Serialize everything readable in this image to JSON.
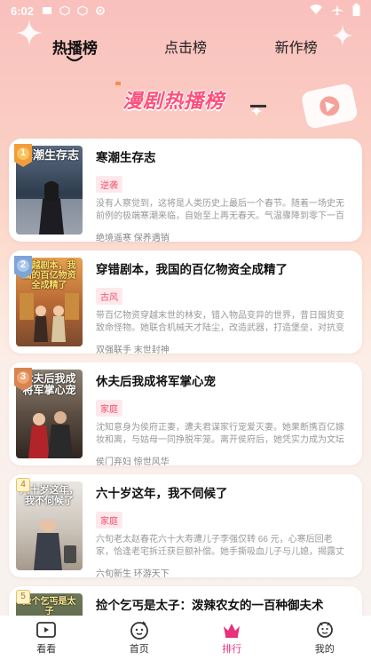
{
  "status_bar": {
    "time": "6:02"
  },
  "tabs": [
    {
      "label": "热播榜",
      "active": true
    },
    {
      "label": "点击榜",
      "active": false
    },
    {
      "label": "新作榜",
      "active": false
    }
  ],
  "banner": {
    "title": "漫剧热播榜"
  },
  "items": [
    {
      "rank": "1",
      "cover_text": "寒潮生存志",
      "title": "寒潮生存志",
      "tag": "逆袭",
      "desc": "没有人察觉到，这将是人类历史上最后一个春节。随着一场史无前例的极端寒潮来临，自始至上再无春天。气温骤降到零下一百度，…",
      "cast": "绝境遥寒  保养遇销"
    },
    {
      "rank": "2",
      "cover_text": "穿越剧本，我国的百亿物资全成精了",
      "title": "穿错剧本，我国的百亿物资全成精了",
      "tag": "古风",
      "desc": "带百亿物资穿越末世的林安，错入物品变异的世界，昔日囤货变致命怪物。她联合机械天才陆尘，改造武器，打造堡垒，对抗变异物…",
      "cast": "双强联手  末世封神"
    },
    {
      "rank": "3",
      "cover_text": "休夫后我成将军掌心宠",
      "title": "休夫后我成将军掌心宠",
      "tag": "家庭",
      "desc": "沈知意身为侯府正妻，遭夫君谋家行宠爱灭妻。她果断携百亿嫁妆和离，与姑母一同挣脱牢笼。离开侯府后，她凭实力成为文坛巨富…",
      "cast": "侯门弃妇  惊世风华"
    },
    {
      "rank": "4",
      "cover_text": "六十岁这年，我不伺候了",
      "title": "六十岁这年，我不伺候了",
      "tag": "家庭",
      "desc": "六旬老太赵春花六十大寿遭儿子李强仅转 66 元，心寒后回老家，恰逢老宅拆迁获巨额补偿。她手撕吸血儿子与儿媳，揭露丈夫被害真…",
      "cast": "六旬新生  环游天下"
    },
    {
      "rank": "5",
      "cover_text": "捡个乞丐是太子",
      "title": "捡个乞丐是太子：泼辣农女的一百种御夫术",
      "tag": "",
      "desc": "",
      "cast": ""
    }
  ],
  "bottom_nav": [
    {
      "label": "看看",
      "icon": "video-icon",
      "active": false
    },
    {
      "label": "首页",
      "icon": "home-face-icon",
      "active": false
    },
    {
      "label": "排行",
      "icon": "crown-icon",
      "active": true
    },
    {
      "label": "我的",
      "icon": "profile-icon",
      "active": false
    }
  ],
  "colors": {
    "accent": "#e8317a",
    "tag": "#f0506b"
  }
}
